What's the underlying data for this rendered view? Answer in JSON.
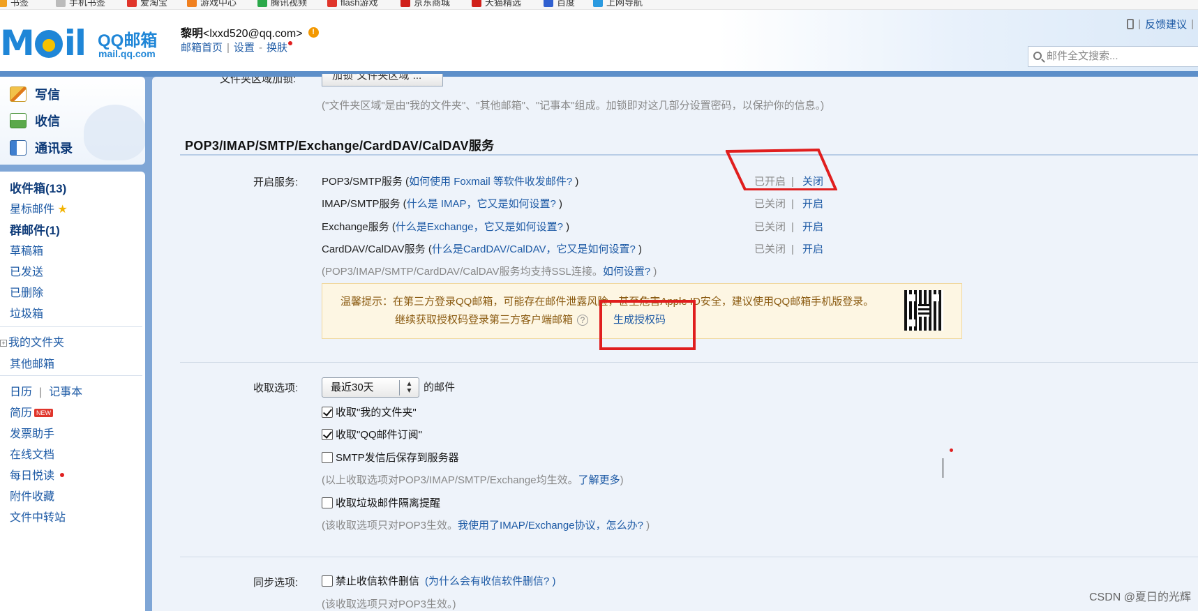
{
  "bookmarks": [
    {
      "label": "书签",
      "color": "#f0a020"
    },
    {
      "label": "手机书签",
      "color": "#bbbbbb"
    },
    {
      "label": "爱淘宝",
      "color": "#e0352b"
    },
    {
      "label": "游戏中心",
      "color": "#f08020"
    },
    {
      "label": "腾讯视频",
      "color": "#2aa84a"
    },
    {
      "label": "flash游戏",
      "color": "#e0352b"
    },
    {
      "label": "京东商城",
      "color": "#d0201a"
    },
    {
      "label": "天猫精选",
      "color": "#d0201a"
    },
    {
      "label": "百度",
      "color": "#3060d0"
    },
    {
      "label": "上网导航",
      "color": "#2a9ae0"
    }
  ],
  "header": {
    "logo_text": "M",
    "logo_text2": "il",
    "logo_brand": "QQ邮箱",
    "logo_domain": "mail.qq.com",
    "user_name": "黎明",
    "user_email": "<lxxd520@qq.com>",
    "link_home": "邮箱首页",
    "link_settings": "设置",
    "link_skin": "换肤",
    "feedback": "反馈建议",
    "search_placeholder": "邮件全文搜索..."
  },
  "sidebar": {
    "actions": [
      {
        "label": "写信",
        "icon": "pencil-icon"
      },
      {
        "label": "收信",
        "icon": "inbox-download-icon"
      },
      {
        "label": "通讯录",
        "icon": "contacts-icon"
      }
    ],
    "inbox": "收件箱(13)",
    "starred": "星标邮件",
    "group": "群邮件(1)",
    "drafts": "草稿箱",
    "sent": "已发送",
    "deleted": "已删除",
    "spam": "垃圾箱",
    "my_folders": "我的文件夹",
    "other_mail": "其他邮箱",
    "calendar": "日历",
    "notes": "记事本",
    "resume": "简历",
    "new_badge": "NEW",
    "invoice": "发票助手",
    "online_docs": "在线文档",
    "daily_read": "每日悦读",
    "attachments": "附件收藏",
    "file_transfer": "文件中转站"
  },
  "main": {
    "cut_label": "文件夹区域加锁:",
    "lock_button": "加锁\"文件夹区域\"...",
    "folder_note": "(\"文件夹区域\"是由\"我的文件夹\"、\"其他邮箱\"、\"记事本\"组成。加锁即对这几部分设置密码，以保护你的信息。)",
    "section_title": "POP3/IMAP/SMTP/Exchange/CardDAV/CalDAV服务",
    "service_label": "开启服务:",
    "services": [
      {
        "name": "POP3/SMTP服务",
        "paren_open": " (",
        "help": "如何使用 Foxmail 等软件收发邮件?",
        "paren_close": " )",
        "status": "已开启",
        "action": "关闭"
      },
      {
        "name": "IMAP/SMTP服务",
        "paren_open": " (",
        "help": "什么是 IMAP，它又是如何设置?",
        "paren_close": " )",
        "status": "已关闭",
        "action": "开启"
      },
      {
        "name": "Exchange服务",
        "paren_open": " (",
        "help": "什么是Exchange，它又是如何设置?",
        "paren_close": " )",
        "status": "已关闭",
        "action": "开启"
      },
      {
        "name": "CardDAV/CalDAV服务",
        "paren_open": " (",
        "help": "什么是CardDAV/CalDAV，它又是如何设置?",
        "paren_close": " )",
        "status": "已关闭",
        "action": "开启"
      }
    ],
    "ssl_note": "(POP3/IMAP/SMTP/CardDAV/CalDAV服务均支持SSL连接。",
    "ssl_link": "如何设置?",
    "ssl_close": " )",
    "tip_line1": "温馨提示：在第三方登录QQ邮箱，可能存在邮件泄露风险，甚至危害Apple ID安全，建议使用QQ邮箱手机版登录。",
    "tip_line2": "继续获取授权码登录第三方客户端邮箱",
    "tip_q": "?",
    "generate_code": "生成授权码",
    "receive_label": "收取选项:",
    "receive_range": "最近30天",
    "receive_suffix": "的邮件",
    "cb_my_folders": "收取\"我的文件夹\"",
    "cb_subscriptions": "收取\"QQ邮件订阅\"",
    "cb_smtp_save": "SMTP发信后保存到服务器",
    "receive_note": "(以上收取选项对POP3/IMAP/SMTP/Exchange均生效。",
    "receive_link": "了解更多",
    "receive_note_close": ")",
    "cb_spam_alert": "收取垃圾邮件隔离提醒",
    "pop_note_a": "(该收取选项只对POP3生效。",
    "pop_note_link": "我使用了IMAP/Exchange协议，怎么办?",
    "pop_note_close": " )",
    "sync_label": "同步选项:",
    "cb_no_delete": "禁止收信软件删信",
    "cb_no_delete_help": "(为什么会有收信软件删信? )",
    "sync_note": "(该收取选项只对POP3生效。)"
  },
  "watermark": "CSDN @夏日的光辉",
  "colors": {
    "accent": "#1d5aa5",
    "sidebar_frame": "#7fa6d6",
    "highlight": "#e01e1e",
    "tip_bg": "#fdf6e3"
  }
}
